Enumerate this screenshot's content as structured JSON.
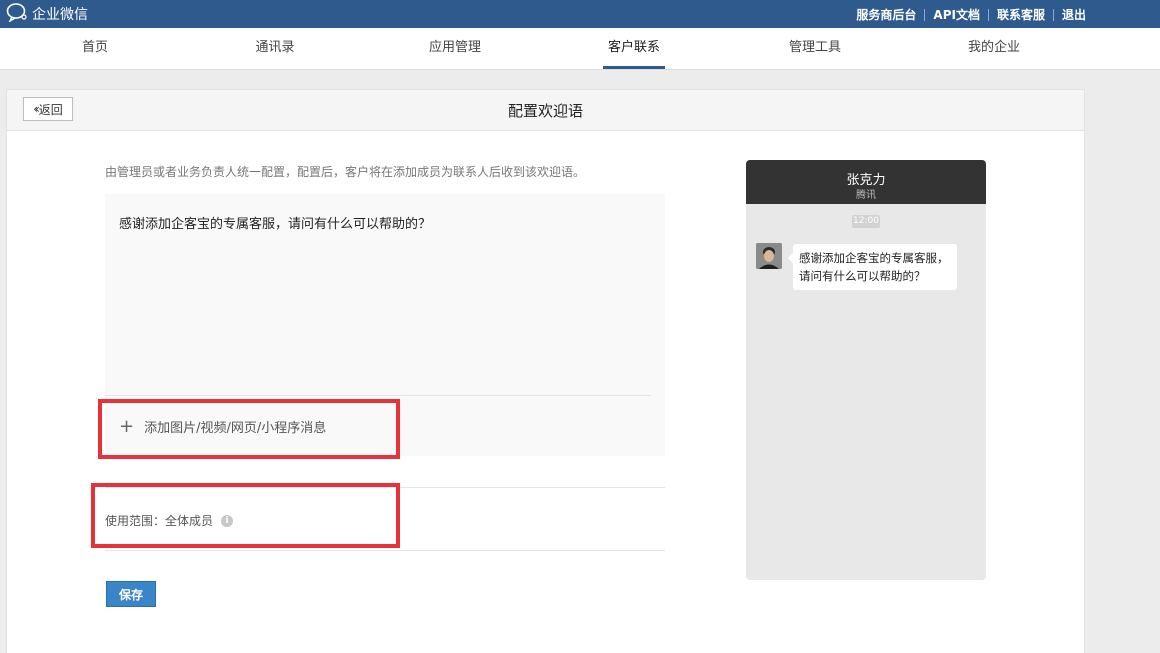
{
  "app": {
    "title": "企业微信"
  },
  "top_links": [
    "服务商后台",
    "API文档",
    "联系客服",
    "退出"
  ],
  "nav": {
    "tabs": [
      "首页",
      "通讯录",
      "应用管理",
      "客户联系",
      "管理工具",
      "我的企业"
    ],
    "active": "客户联系"
  },
  "page": {
    "back_label": "返回",
    "title": "配置欢迎语",
    "description": "由管理员或者业务负责人统一配置，配置后，客户将在添加成员为联系人后收到该欢迎语。",
    "message": "感谢添加企客宝的专属客服，请问有什么可以帮助的？",
    "attach_label": "添加图片/视频/网页/小程序消息",
    "scope_label": "使用范围：",
    "scope_value": "全体成员",
    "save_label": "保存"
  },
  "preview": {
    "name": "张克力",
    "org": "腾讯",
    "time": "12:00",
    "message": "感谢添加企客宝的专属客服，请问有什么可以帮助的？"
  },
  "colors": {
    "brand": "#2f5a8e",
    "highlight": "#e8323a",
    "save": "#3a84c8"
  }
}
